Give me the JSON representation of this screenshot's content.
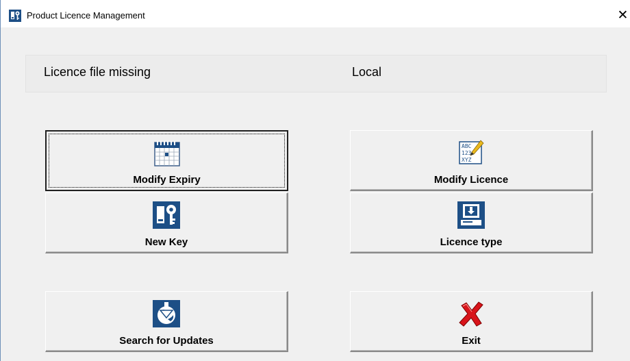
{
  "window": {
    "title": "Product Licence Management"
  },
  "status": {
    "licence_state": "Licence file missing",
    "mode": "Local"
  },
  "buttons": {
    "modify_expiry": {
      "label": "Modify Expiry",
      "icon": "calendar-icon"
    },
    "modify_licence": {
      "label": "Modify Licence",
      "icon": "abc-123-edit-icon"
    },
    "new_key": {
      "label": "New Key",
      "icon": "key-icon"
    },
    "licence_type": {
      "label": "Licence type",
      "icon": "network-computer-icon"
    },
    "search_updates": {
      "label": "Search for Updates",
      "icon": "globe-download-icon"
    },
    "exit": {
      "label": "Exit",
      "icon": "red-x-icon"
    }
  },
  "colors": {
    "icon_blue": "#1d4f86",
    "exit_red": "#d8141a"
  }
}
